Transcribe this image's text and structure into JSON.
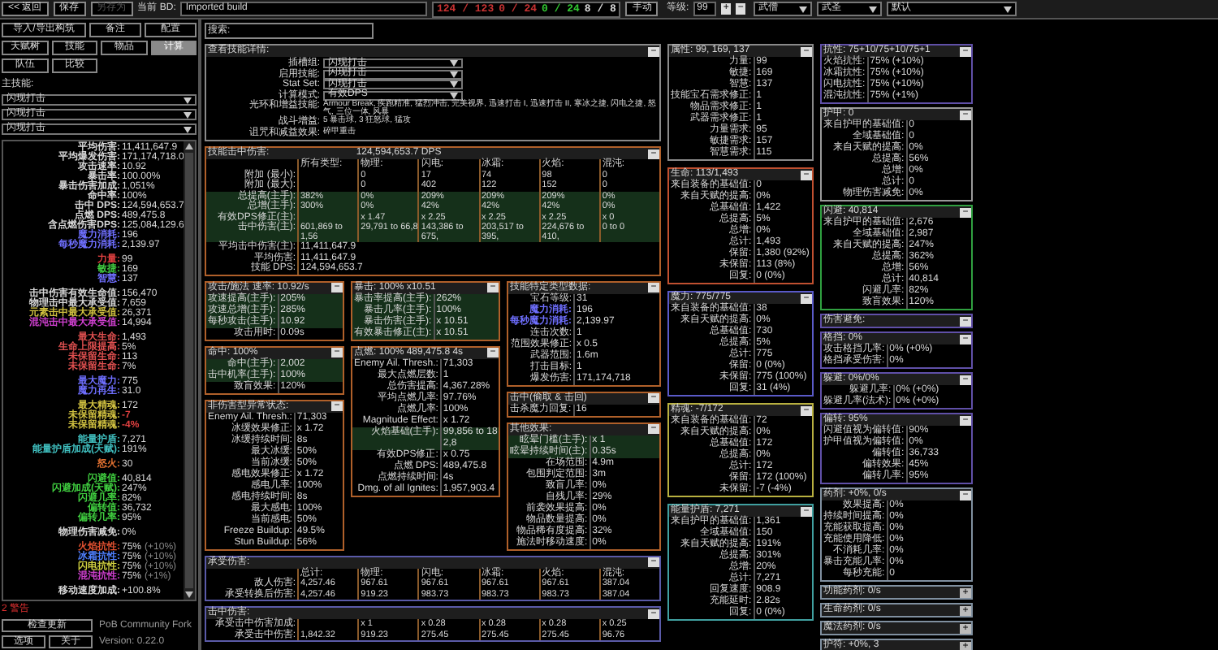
{
  "top_bar": {
    "buttons": [
      {
        "label": "<< 返回",
        "disabled": false
      },
      {
        "label": "保存",
        "disabled": false
      },
      {
        "label": "另存为",
        "disabled": true
      }
    ],
    "build_label": "当前 BD:",
    "build_name": "Imported build",
    "counters": [
      {
        "text": "124 / 123",
        "color": "#c83232"
      },
      {
        "text": "0 / 24",
        "color": "#c83232"
      },
      {
        "text": "0 / 24",
        "color": "#32c832"
      },
      {
        "text": "8 / 8",
        "color": "#d8d8d8"
      }
    ],
    "mode_button": "手动",
    "level_label": "等级:",
    "level": "99",
    "plus": "+",
    "minus": "−",
    "class": "武僧",
    "ascendancy": "武圣",
    "config": "默认"
  },
  "left": {
    "buttons": [
      "导入/导出构筑",
      "备注",
      "配置"
    ],
    "tabs": [
      {
        "label": "天赋树",
        "selected": false
      },
      {
        "label": "技能",
        "selected": false
      },
      {
        "label": "物品",
        "selected": false
      },
      {
        "label": "计算",
        "selected": true
      },
      {
        "label": "队伍",
        "selected": false
      },
      {
        "label": "比较",
        "selected": false
      }
    ],
    "main_skill_label": "主技能:",
    "skill_selects": [
      "闪现打击",
      "闪现打击",
      "闪现打击"
    ],
    "stat_groups": [
      [
        {
          "label": "平均伤害:",
          "value": "11,411,647.9",
          "color": "#d8d8d8"
        },
        {
          "label": "平均爆发伤害:",
          "value": "171,174,718.0",
          "color": "#d8d8d8"
        },
        {
          "label": "攻击速率:",
          "value": "10.92",
          "color": "#d8d8d8"
        },
        {
          "label": "暴击率:",
          "value": "100.00%",
          "color": "#d8d8d8"
        },
        {
          "label": "暴击伤害加成:",
          "value": "1,051%",
          "color": "#d8d8d8"
        },
        {
          "label": "命中率:",
          "value": "100%",
          "color": "#d8d8d8"
        },
        {
          "label": "击中 DPS:",
          "value": "124,594,653.7",
          "color": "#d8d8d8"
        },
        {
          "label": "点燃 DPS:",
          "value": "489,475.8",
          "color": "#d8d8d8"
        },
        {
          "label": "含点燃伤害DPS:",
          "value": "125,084,129.6",
          "color": "#d8d8d8"
        },
        {
          "label": "魔力消耗:",
          "value": "196",
          "color": "#6f6fff"
        },
        {
          "label": "每秒魔力消耗:",
          "value": "2,139.97",
          "color": "#6f6fff"
        }
      ],
      [
        {
          "label": "力量:",
          "value": "99",
          "color": "#e04040"
        },
        {
          "label": "敏捷:",
          "value": "169",
          "color": "#40c840"
        },
        {
          "label": "智慧:",
          "value": "137",
          "color": "#6f6fff"
        }
      ],
      [
        {
          "label": "击中伤害有效生命值:",
          "value": "156,470",
          "color": "#d8d8d8"
        },
        {
          "label": "物理击中最大承受值:",
          "value": "7,659",
          "color": "#d8d8d8"
        },
        {
          "label": "元素击中最大承受值:",
          "value": "26,371",
          "color": "#d0c040"
        },
        {
          "label": "混沌击中最大承受值:",
          "value": "14,994",
          "color": "#d040d0"
        }
      ],
      [
        {
          "label": "最大生命:",
          "value": "1,493",
          "color": "#e05050"
        },
        {
          "label": "生命上限提高:",
          "value": "5%",
          "color": "#e05050"
        },
        {
          "label": "未保留生命:",
          "value": "113",
          "color": "#e05050"
        },
        {
          "label": "未保留生命:",
          "value": "7%",
          "color": "#e05050"
        }
      ],
      [
        {
          "label": "最大魔力:",
          "value": "775",
          "color": "#6f6fff"
        },
        {
          "label": "魔力再生:",
          "value": "31.0",
          "color": "#6f6fff"
        }
      ],
      [
        {
          "label": "最大精魂:",
          "value": "172",
          "color": "#d0c040"
        },
        {
          "label": "未保留精魂:",
          "value": {
            "text": "-7",
            "color": "#e04040"
          },
          "color": "#d0c040"
        },
        {
          "label": "未保留精魂:",
          "value": {
            "text": "-4%",
            "color": "#e04040"
          },
          "color": "#d0c040"
        }
      ],
      [
        {
          "label": "能量护盾:",
          "value": "7,271",
          "color": "#40c0c0"
        },
        {
          "label": "能量护盾加成(天赋):",
          "value": "191%",
          "color": "#40c0c0"
        }
      ],
      [
        {
          "label": "怒火:",
          "value": "30",
          "color": "#e07030"
        }
      ],
      [
        {
          "label": "闪避值:",
          "value": "40,814",
          "color": "#40d040"
        },
        {
          "label": "闪避加成(天赋):",
          "value": "247%",
          "color": "#40d040"
        },
        {
          "label": "闪避几率:",
          "value": "82%",
          "color": "#40d040"
        },
        {
          "label": "偏转值:",
          "value": "36,732",
          "color": "#40d040"
        },
        {
          "label": "偏转几率:",
          "value": "95%",
          "color": "#40d040"
        }
      ],
      [
        {
          "label": "物理伤害减免:",
          "value": "0%",
          "color": "#d8d8d8"
        }
      ],
      [
        {
          "label": "火焰抗性:",
          "value": "75%",
          "extra": "(+10%)",
          "color": "#e05030"
        },
        {
          "label": "冰霜抗性:",
          "value": "75%",
          "extra": "(+10%)",
          "color": "#5080ff"
        },
        {
          "label": "闪电抗性:",
          "value": "75%",
          "extra": "(+10%)",
          "color": "#d0d040"
        },
        {
          "label": "混沌抗性:",
          "value": "75%",
          "extra": "(+1%)",
          "color": "#d040d0"
        }
      ],
      [
        {
          "label": "移动速度加成:",
          "value": "+100.8%",
          "color": "#d8d8d8"
        }
      ]
    ],
    "warning": "2 警告",
    "update_button": "检查更新",
    "fork": "PoB Community Fork",
    "options_button": "选项",
    "about_button": "关于",
    "version": "Version: 0.22.0"
  },
  "search": {
    "placeholder": "搜索:"
  },
  "column_a": {
    "details": {
      "title": "查看技能详情:",
      "color": "#8a8a8a",
      "toggle": "−",
      "collapsed": false,
      "kind": "fields",
      "rows": [
        {
          "label": "插槽组:",
          "value": "闪现打击",
          "kind": "select"
        },
        {
          "label": "启用技能:",
          "value": "闪现打击",
          "kind": "select"
        },
        {
          "label": "Stat Set:",
          "value": "闪现打击",
          "kind": "select"
        },
        {
          "label": "计算模式:",
          "value": "有效DPS",
          "kind": "select"
        },
        {
          "label": "光环和增益技能:",
          "value": "Armour Break, 疾跑精准, 猛烈冲击, 完美视界, 迅速打击 I, 迅速打击 II, 寒冰之捷, 闪电之捷, 怒气, 三位一体, 风暴",
          "kind": "text"
        },
        {
          "label": "战斗增益:",
          "value": "5 暴击球, 3 狂怒球, 猛攻",
          "kind": "text"
        },
        {
          "label": "诅咒和减益效果:",
          "value": "碎甲重击",
          "kind": "text"
        }
      ]
    },
    "hit": {
      "title": "技能击中伤害:",
      "summary": "124,594,653.7 DPS",
      "color": "#b0602a",
      "toggle": "−",
      "collapsed": false,
      "kind": "table",
      "columns": [
        "所有类型:",
        "物理:",
        "闪电:",
        "冰霜:",
        "火焰:",
        "混沌:"
      ],
      "rows": [
        {
          "label": "附加 (最小):",
          "cells": [
            null,
            "0",
            "17",
            "74",
            "98",
            "0"
          ],
          "highlighted": false
        },
        {
          "label": "附加 (最大):",
          "cells": [
            null,
            "0",
            "402",
            "122",
            "152",
            "0"
          ],
          "highlighted": false
        },
        {
          "label": "总提高(主手):",
          "cells": [
            "382%",
            "0%",
            "209%",
            "209%",
            "209%",
            "0%"
          ],
          "highlighted": true
        },
        {
          "label": "总增(主手):",
          "cells": [
            "300%",
            "0%",
            "42%",
            "42%",
            "42%",
            "0%"
          ],
          "highlighted": true
        },
        {
          "label": "有效DPS修正(主):",
          "cells": [
            null,
            "x 1.47",
            "x 2.25",
            "x 2.25",
            "x 2.25",
            "x 0"
          ],
          "highlighted": true
        },
        {
          "label": "击中伤害(主):",
          "cells": [
            "601,869 to 1,56",
            "29,791 to 66,8",
            "143,386 to 675,",
            "203,517 to 395,",
            "224,676 to 410,",
            "0 to 0"
          ],
          "highlighted": true
        },
        {
          "label": "平均击中伤害(主):",
          "cells": [
            "11,411,647.9"
          ],
          "highlighted": false
        },
        {
          "label": "平均伤害:",
          "cells": [
            "11,411,647.9"
          ],
          "highlighted": false
        },
        {
          "label": "技能 DPS:",
          "cells": [
            "124,594,653.7"
          ],
          "highlighted": false
        }
      ]
    },
    "sub_columns": [
      [
        {
          "title": "攻击/施法 速率: 10.92/s",
          "color": "#b0602a",
          "toggle": "−",
          "collapsed": false,
          "kind": "rows",
          "rows": [
            {
              "label": "攻速提高(主手):",
              "value": "205%",
              "highlighted": true
            },
            {
              "label": "攻速总增(主手):",
              "value": "285%",
              "highlighted": true
            },
            {
              "label": "每秒攻击(主手):",
              "value": "10.92",
              "highlighted": true
            },
            {
              "label": "攻击用时:",
              "value": "0.09s",
              "highlighted": false
            }
          ]
        },
        {
          "title": "命中: 100%",
          "color": "#b0602a",
          "toggle": "−",
          "collapsed": false,
          "kind": "rows",
          "rows": [
            {
              "label": "命中(主手):",
              "value": "2,002",
              "highlighted": true
            },
            {
              "label": "击中机率(主手):",
              "value": "100%",
              "highlighted": true
            },
            {
              "label": "致盲效果:",
              "value": "120%",
              "highlighted": false
            }
          ]
        },
        {
          "title": "非伤害型异常状态:",
          "color": "#b0602a",
          "toggle": "−",
          "collapsed": false,
          "kind": "rows",
          "rows": [
            {
              "label": "Enemy Ail. Thresh.:",
              "value": "71,303",
              "highlighted": false
            },
            {
              "label": "冰缓效果修正:",
              "value": "x 1.72",
              "highlighted": false
            },
            {
              "label": "冰缓持续时间:",
              "value": "8s",
              "highlighted": false
            },
            {
              "label": "最大冰缓:",
              "value": "50%",
              "highlighted": false
            },
            {
              "label": "当前冰缓:",
              "value": "50%",
              "highlighted": false
            },
            {
              "label": "感电效果修正:",
              "value": "x 1.72",
              "highlighted": false
            },
            {
              "label": "感电几率:",
              "value": "100%",
              "highlighted": false
            },
            {
              "label": "感电持续时间:",
              "value": "8s",
              "highlighted": false
            },
            {
              "label": "最大感电:",
              "value": "100%",
              "highlighted": false
            },
            {
              "label": "当前感电:",
              "value": "50%",
              "highlighted": false
            },
            {
              "label": "Freeze Buildup:",
              "value": "49.5%",
              "highlighted": false
            },
            {
              "label": "Stun Buildup:",
              "value": "56%",
              "highlighted": false
            }
          ]
        }
      ],
      [
        {
          "title": "暴击: 100% x10.51",
          "color": "#b0602a",
          "toggle": "−",
          "collapsed": false,
          "kind": "rows",
          "rows": [
            {
              "label": "暴击率提高(主手):",
              "value": "262%",
              "highlighted": true
            },
            {
              "label": "暴击几率(主手):",
              "value": "100%",
              "highlighted": true
            },
            {
              "label": "暴击伤害(主手):",
              "value": "x 10.51",
              "highlighted": true
            },
            {
              "label": "有效暴击修正(主):",
              "value": "x 10.51",
              "highlighted": true
            }
          ]
        },
        {
          "title": "点燃: 100% 489,475.8 4s",
          "color": "#b0602a",
          "toggle": "−",
          "collapsed": false,
          "kind": "rows",
          "rows": [
            {
              "label": "Enemy Ail. Thresh.:",
              "value": "71,303",
              "highlighted": false
            },
            {
              "label": "最大点燃层数:",
              "value": "1",
              "highlighted": false
            },
            {
              "label": "总伤害提高:",
              "value": "4,367.28%",
              "highlighted": false
            },
            {
              "label": "平均点燃几率:",
              "value": "97.76%",
              "highlighted": false
            },
            {
              "label": "点燃几率:",
              "value": "100%",
              "highlighted": false
            },
            {
              "label": "Magnitude Effect:",
              "value": "x 1.72",
              "highlighted": false
            },
            {
              "label": "火焰基础(主手):",
              "value": "99,856 to 182,8",
              "highlighted": true
            },
            {
              "label": "有效DPS修正:",
              "value": "x 0.75",
              "highlighted": false
            },
            {
              "label": "点燃 DPS:",
              "value": "489,475.8",
              "highlighted": false
            },
            {
              "label": "点燃持续时间:",
              "value": "4s",
              "highlighted": false
            },
            {
              "label": "Dmg. of all Ignites:",
              "value": "1,957,903.4",
              "highlighted": false
            }
          ]
        }
      ],
      [
        {
          "title": "技能特定类型数据:",
          "color": "#b0602a",
          "toggle": "−",
          "collapsed": false,
          "kind": "rows",
          "rows": [
            {
              "label": "宝石等级:",
              "value": "31"
            },
            {
              "label": {
                "text": "魔力消耗:",
                "color": "#6f6fff"
              },
              "value": "196"
            },
            {
              "label": {
                "text": "每秒魔力消耗:",
                "color": "#6f6fff"
              },
              "value": "2,139.97"
            },
            {
              "label": "连击次数:",
              "value": "1"
            },
            {
              "label": "范围效果修正:",
              "value": "x 0.5"
            },
            {
              "label": "武器范围:",
              "value": "1.6m"
            },
            {
              "label": "打击目标:",
              "value": "1"
            },
            {
              "label": "爆发伤害:",
              "value": "171,174,718"
            }
          ]
        },
        {
          "title": "击中(偷取 & 击回)",
          "color": "#b0602a",
          "toggle": "−",
          "collapsed": false,
          "kind": "rows",
          "rows": [
            {
              "label": "击杀魔力回复:",
              "value": "16"
            }
          ]
        },
        {
          "title": "其他效果:",
          "color": "#b0602a",
          "toggle": "−",
          "collapsed": false,
          "kind": "rows",
          "rows": [
            {
              "label": "眩晕门槛(主手):",
              "value": "x 1",
              "highlighted": true
            },
            {
              "label": "眩晕持续时间(主):",
              "value": "0.35s",
              "highlighted": true
            },
            {
              "label": "在场范围:",
              "value": "4.9m",
              "highlighted": false
            },
            {
              "label": "包围判定范围:",
              "value": "3m",
              "highlighted": false
            },
            {
              "label": "致盲几率:",
              "value": "0%",
              "highlighted": false
            },
            {
              "label": "自残几率:",
              "value": "29%",
              "highlighted": false
            },
            {
              "label": "前袭效果提高:",
              "value": "0%",
              "highlighted": false
            },
            {
              "label": "物品数量提高:",
              "value": "0%",
              "highlighted": false
            },
            {
              "label": "物品稀有度提高:",
              "value": "32%",
              "highlighted": false
            },
            {
              "label": "施法时移动速度:",
              "value": "0%",
              "highlighted": false
            }
          ]
        }
      ]
    ],
    "taken": {
      "title": "承受伤害:",
      "color": "#5a5aa8",
      "toggle": "−",
      "collapsed": false,
      "kind": "table",
      "columns": [
        "总计:",
        "物理:",
        "闪电:",
        "冰霜:",
        "火焰:",
        "混沌:"
      ],
      "rows": [
        {
          "label": "敌人伤害:",
          "cells": [
            "4,257.46",
            "967.61",
            "967.61",
            "967.61",
            "967.61",
            "387.04"
          ],
          "highlighted": false
        },
        {
          "label": "承受转换后伤害:",
          "cells": [
            "4,257.46",
            "919.23",
            "983.73",
            "983.73",
            "983.73",
            "387.04"
          ],
          "highlighted": false
        }
      ]
    },
    "hit_taken": {
      "title": "击中伤害:",
      "color": "#5a5aa8",
      "toggle": "−",
      "collapsed": false,
      "kind": "table",
      "rows": [
        {
          "label": "承受击中伤害加成:",
          "cells": [
            null,
            "x 1",
            "x 0.28",
            "x 0.28",
            "x 0.28",
            "x 0.25"
          ],
          "highlighted": false
        },
        {
          "label": "承受击中伤害:",
          "cells": [
            "1,842.32",
            "919.23",
            "275.45",
            "275.45",
            "275.45",
            "96.76"
          ],
          "highlighted": false
        }
      ]
    }
  },
  "column_b": [
    {
      "title": "属性: 99, 169, 137",
      "color": "#8a8a8a",
      "toggle": "−",
      "collapsed": false,
      "kind": "rows",
      "rows": [
        {
          "label": "力量:",
          "value": "99"
        },
        {
          "label": "敏捷:",
          "value": "169"
        },
        {
          "label": "智慧:",
          "value": "137"
        },
        {
          "label": "技能宝石需求修正:",
          "value": "1"
        },
        {
          "label": "物品需求修正:",
          "value": "1"
        },
        {
          "label": "武器需求修正:",
          "value": "1"
        },
        {
          "label": "力量需求:",
          "value": "95"
        },
        {
          "label": "敏捷需求:",
          "value": "157"
        },
        {
          "label": "智慧需求:",
          "value": "115"
        }
      ]
    },
    {
      "title": "生命: 113/1,493",
      "color": "#c05030",
      "toggle": "−",
      "collapsed": false,
      "kind": "rows",
      "rows": [
        {
          "label": "来自装备的基础值:",
          "value": "0"
        },
        {
          "label": "来自天赋的提高:",
          "value": "0%"
        },
        {
          "label": "总基础值:",
          "value": "1,422"
        },
        {
          "label": "总提高:",
          "value": "5%"
        },
        {
          "label": "总增:",
          "value": "0%"
        },
        {
          "label": "总计:",
          "value": "1,493"
        },
        {
          "label": "保留:",
          "value": "1,380 (92%)"
        },
        {
          "label": "未保留:",
          "value": "113 (8%)"
        },
        {
          "label": "回复:",
          "value": "0 (0%)"
        }
      ]
    },
    {
      "title": "魔力: 775/775",
      "color": "#5a5ac8",
      "toggle": "−",
      "collapsed": false,
      "kind": "rows",
      "rows": [
        {
          "label": "来自装备的基础值:",
          "value": "38"
        },
        {
          "label": "来自天赋的提高:",
          "value": "0%"
        },
        {
          "label": "总基础值:",
          "value": "730"
        },
        {
          "label": "总提高:",
          "value": "5%"
        },
        {
          "label": "总计:",
          "value": "775"
        },
        {
          "label": "保留:",
          "value": "0 (0%)"
        },
        {
          "label": "未保留:",
          "value": "775 (100%)"
        },
        {
          "label": "回复:",
          "value": "31 (4%)"
        }
      ]
    },
    {
      "title": "精魂: -7/172",
      "color": "#b8b040",
      "toggle": "−",
      "collapsed": false,
      "kind": "rows",
      "rows": [
        {
          "label": "来自装备的基础值:",
          "value": "72"
        },
        {
          "label": "来自天赋的提高:",
          "value": "0%"
        },
        {
          "label": "总基础值:",
          "value": "172"
        },
        {
          "label": "总提高:",
          "value": "0%"
        },
        {
          "label": "总计:",
          "value": "172"
        },
        {
          "label": "保留:",
          "value": "172 (100%)"
        },
        {
          "label": "未保留:",
          "value": "-7 (-4%)"
        }
      ]
    },
    {
      "title": "能量护盾: 7,271",
      "color": "#40a0a0",
      "toggle": "−",
      "collapsed": false,
      "kind": "rows",
      "rows": [
        {
          "label": "来自护甲的基础值:",
          "value": "1,361"
        },
        {
          "label": "全域基础值:",
          "value": "150"
        },
        {
          "label": "来自天赋的提高:",
          "value": "191%"
        },
        {
          "label": "总提高:",
          "value": "301%"
        },
        {
          "label": "总增:",
          "value": "20%"
        },
        {
          "label": "总计:",
          "value": "7,271"
        },
        {
          "label": "回复速度:",
          "value": "908.9"
        },
        {
          "label": "充能延时:",
          "value": "2.82s"
        },
        {
          "label": "回复:",
          "value": "0 (0%)"
        }
      ]
    }
  ],
  "column_c": [
    {
      "title": "抗性: 75+10/75+10/75+1",
      "color": "#6050a8",
      "toggle": "−",
      "collapsed": false,
      "kind": "rows",
      "rows": [
        {
          "label": "火焰抗性:",
          "value": "75% (+10%)"
        },
        {
          "label": "冰霜抗性:",
          "value": "75% (+10%)"
        },
        {
          "label": "闪电抗性:",
          "value": "75% (+10%)"
        },
        {
          "label": "混沌抗性:",
          "value": "75% (+1%)"
        }
      ]
    },
    {
      "title": "护甲: 0",
      "color": "#9a9a9a",
      "toggle": "−",
      "collapsed": false,
      "kind": "rows",
      "rows": [
        {
          "label": "来自护甲的基础值:",
          "value": "0"
        },
        {
          "label": "全域基础值:",
          "value": "0"
        },
        {
          "label": "来自天赋的提高:",
          "value": "0%"
        },
        {
          "label": "总提高:",
          "value": "56%"
        },
        {
          "label": "总增:",
          "value": "0%"
        },
        {
          "label": "总计:",
          "value": "0"
        },
        {
          "label": "物理伤害减免:",
          "value": "0%"
        }
      ]
    },
    {
      "title": "闪避: 40,814",
      "color": "#30a040",
      "toggle": "−",
      "collapsed": false,
      "kind": "rows",
      "rows": [
        {
          "label": "来自护甲的基础值:",
          "value": "2,676"
        },
        {
          "label": "全域基础值:",
          "value": "2,987"
        },
        {
          "label": "来自天赋的提高:",
          "value": "247%"
        },
        {
          "label": "总提高:",
          "value": "362%"
        },
        {
          "label": "总增:",
          "value": "56%"
        },
        {
          "label": "总计:",
          "value": "40,814"
        },
        {
          "label": "闪避几率:",
          "value": "82%"
        },
        {
          "label": "致盲效果:",
          "value": "120%"
        }
      ]
    },
    {
      "title": "伤害避免:",
      "color": "#6050a8",
      "toggle": "−",
      "collapsed": false,
      "kind": "header"
    },
    {
      "title": "格挡: 0%",
      "color": "#6050a8",
      "toggle": "−",
      "collapsed": false,
      "kind": "rows",
      "rows": [
        {
          "label": "攻击格挡几率:",
          "value": "0% (+0%)"
        },
        {
          "label": "格挡承受伤害:",
          "value": "0%"
        }
      ]
    },
    {
      "title": "躲避:  0%/0%",
      "color": "#6050a8",
      "toggle": "−",
      "collapsed": false,
      "kind": "rows",
      "rows": [
        {
          "label": "躲避几率:",
          "value": "0% (+0%)"
        },
        {
          "label": "躲避几率(法术):",
          "value": "0% (+0%)"
        }
      ]
    },
    {
      "title": "偏转: 95%",
      "color": "#6050a8",
      "toggle": "−",
      "collapsed": false,
      "kind": "rows",
      "rows": [
        {
          "label": "闪避值视为偏转值:",
          "value": "90%"
        },
        {
          "label": "护甲值视为偏转值:",
          "value": "0%"
        },
        {
          "label": "偏转值:",
          "value": "36,733"
        },
        {
          "label": "偏转效果:",
          "value": "45%"
        },
        {
          "label": "偏转几率:",
          "value": "95%"
        }
      ]
    },
    {
      "title": "药剂:   +0%, 0/s",
      "color": "#8090a0",
      "toggle": "−",
      "collapsed": false,
      "kind": "rows",
      "rows": [
        {
          "label": "效果提高:",
          "value": "0%"
        },
        {
          "label": "持续时间提高:",
          "value": "0%"
        },
        {
          "label": "充能获取提高:",
          "value": "0%"
        },
        {
          "label": "充能使用降低:",
          "value": "0%"
        },
        {
          "label": "不消耗几率:",
          "value": "0%"
        },
        {
          "label": "暴击充能几率:",
          "value": "0%"
        },
        {
          "label": "每秒充能:",
          "value": "0"
        }
      ]
    },
    {
      "title": "功能药剂:      0/s",
      "color": "#8090a0",
      "toggle": "+",
      "collapsed": true
    },
    {
      "title": "生命药剂:  0/s",
      "color": "#8090a0",
      "toggle": "+",
      "collapsed": true
    },
    {
      "title": "魔法药剂:  0/s",
      "color": "#8090a0",
      "toggle": "+",
      "collapsed": true
    },
    {
      "title": "护符:    +0%, 3",
      "color": "#8090a0",
      "toggle": "+",
      "collapsed": true
    }
  ]
}
